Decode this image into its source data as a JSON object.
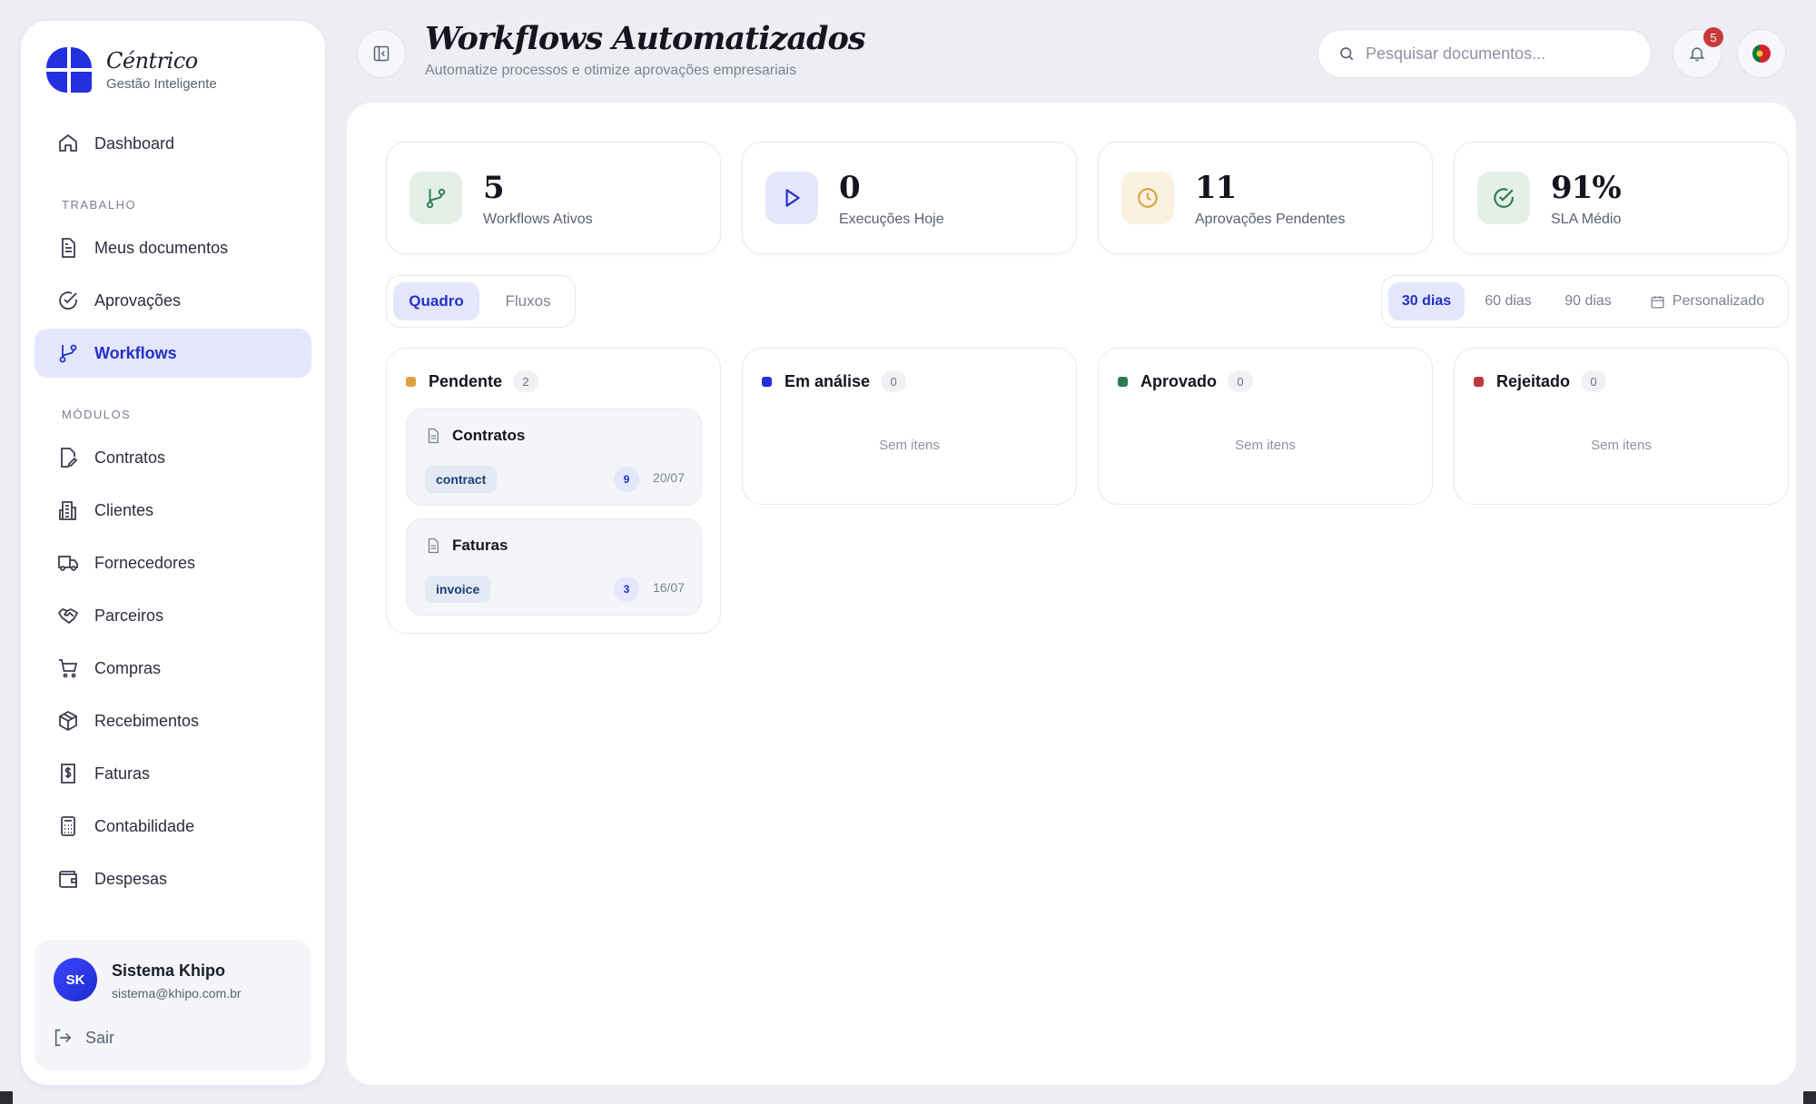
{
  "brand": {
    "name": "Céntrico",
    "subtitle": "Gestão Inteligente"
  },
  "sidebar": {
    "items": [
      {
        "label": "Dashboard",
        "icon": "home-icon"
      },
      {
        "label": "Meus documentos",
        "icon": "document-icon"
      },
      {
        "label": "Aprovações",
        "icon": "check-circle-icon"
      },
      {
        "label": "Workflows",
        "icon": "git-branch-icon",
        "active": true
      },
      {
        "label": "Contratos",
        "icon": "file-pen-icon"
      },
      {
        "label": "Clientes",
        "icon": "building-icon"
      },
      {
        "label": "Fornecedores",
        "icon": "truck-icon"
      },
      {
        "label": "Parceiros",
        "icon": "handshake-icon"
      },
      {
        "label": "Compras",
        "icon": "cart-icon"
      },
      {
        "label": "Recebimentos",
        "icon": "package-icon"
      },
      {
        "label": "Faturas",
        "icon": "receipt-icon"
      },
      {
        "label": "Contabilidade",
        "icon": "calculator-icon"
      },
      {
        "label": "Despesas",
        "icon": "wallet-icon"
      }
    ],
    "sections": {
      "work": "TRABALHO",
      "modules": "MÓDULOS"
    }
  },
  "user": {
    "initials": "SK",
    "name": "Sistema Khipo",
    "email": "sistema@khipo.com.br",
    "logout_label": "Sair"
  },
  "header": {
    "title": "Workflows Automatizados",
    "subtitle": "Automatize processos e otimize aprovações empresariais",
    "search_placeholder": "Pesquisar documentos...",
    "notification_count": "5"
  },
  "stats": [
    {
      "value": "5",
      "label": "Workflows Ativos",
      "icon": "git-branch-icon",
      "color": "#2e7d4f"
    },
    {
      "value": "0",
      "label": "Execuções Hoje",
      "icon": "play-icon",
      "color": "#2430c9"
    },
    {
      "value": "11",
      "label": "Aprovações Pendentes",
      "icon": "clock-icon",
      "color": "#e0a040"
    },
    {
      "value": "91%",
      "label": "SLA Médio",
      "icon": "check-circle-icon",
      "color": "#2e7d4f"
    }
  ],
  "view_tabs": {
    "board": "Quadro",
    "flows": "Fluxos",
    "selected": "Quadro"
  },
  "ranges": {
    "r30": "30 dias",
    "r60": "60 dias",
    "r90": "90 dias",
    "custom": "Personalizado",
    "selected": "30 dias"
  },
  "columns": [
    {
      "title": "Pendente",
      "count": "2",
      "color": "#e0a040",
      "cards": [
        {
          "title": "Contratos",
          "tag": "contract",
          "num": "9",
          "date": "20/07"
        },
        {
          "title": "Faturas",
          "tag": "invoice",
          "num": "3",
          "date": "16/07"
        }
      ]
    },
    {
      "title": "Em análise",
      "count": "0",
      "color": "#2430e0",
      "empty": "Sem itens"
    },
    {
      "title": "Aprovado",
      "count": "0",
      "color": "#2e7d4f",
      "empty": "Sem itens"
    },
    {
      "title": "Rejeitado",
      "count": "0",
      "color": "#c0393b",
      "empty": "Sem itens"
    }
  ]
}
